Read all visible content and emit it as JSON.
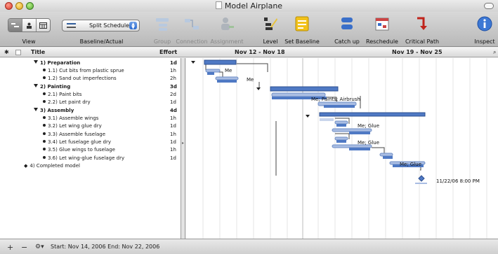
{
  "window": {
    "title": "Model Airplane"
  },
  "toolbar": {
    "view_label": "View",
    "baseline_label": "Baseline/Actual",
    "baseline_popup_value": "Split Schedule",
    "buttons": [
      {
        "label": "Group",
        "enabled": false,
        "icon": "group-icon"
      },
      {
        "label": "Connection",
        "enabled": false,
        "icon": "connection-icon"
      },
      {
        "label": "Assignment",
        "enabled": false,
        "icon": "assignment-icon"
      },
      {
        "label": "Level",
        "enabled": true,
        "icon": "level-icon"
      },
      {
        "label": "Set Baseline",
        "enabled": true,
        "icon": "set-baseline-icon"
      },
      {
        "label": "Catch up",
        "enabled": true,
        "icon": "catch-up-icon"
      },
      {
        "label": "Reschedule",
        "enabled": true,
        "icon": "reschedule-icon"
      },
      {
        "label": "Critical Path",
        "enabled": true,
        "icon": "critical-path-icon"
      },
      {
        "label": "Inspect",
        "enabled": true,
        "icon": "inspect-icon"
      }
    ]
  },
  "columns": {
    "title": "Title",
    "effort": "Effort"
  },
  "timeline": {
    "weeks": [
      "Nov 12 - Nov 18",
      "Nov 19 - Nov 25"
    ]
  },
  "tasks": [
    {
      "title": "1) Preparation",
      "effort": "1d",
      "level": 0,
      "kind": "group"
    },
    {
      "title": "1.1) Cut bits from plastic sprue",
      "effort": "1h",
      "level": 1,
      "kind": "task"
    },
    {
      "title": "1.2) Sand out imperfections",
      "effort": "2h",
      "level": 1,
      "kind": "task"
    },
    {
      "title": "2) Painting",
      "effort": "3d",
      "level": 0,
      "kind": "group"
    },
    {
      "title": "2.1) Paint bits",
      "effort": "2d",
      "level": 1,
      "kind": "task"
    },
    {
      "title": "2.2) Let paint dry",
      "effort": "1d",
      "level": 1,
      "kind": "task"
    },
    {
      "title": "3) Assembly",
      "effort": "4d",
      "level": 0,
      "kind": "group"
    },
    {
      "title": "3.1) Assemble wings",
      "effort": "1h",
      "level": 1,
      "kind": "task"
    },
    {
      "title": "3.2) Let wing glue dry",
      "effort": "1d",
      "level": 1,
      "kind": "task"
    },
    {
      "title": "3.3) Assemble fuselage",
      "effort": "1h",
      "level": 1,
      "kind": "task"
    },
    {
      "title": "3.4) Let fuselage glue dry",
      "effort": "1d",
      "level": 1,
      "kind": "task"
    },
    {
      "title": "3.5) Glue wings to fuselage",
      "effort": "1h",
      "level": 1,
      "kind": "task"
    },
    {
      "title": "3.6) Let wing-glue fuselage dry",
      "effort": "1d",
      "level": 1,
      "kind": "task"
    },
    {
      "title": "4) Completed model",
      "effort": "",
      "level": 0,
      "kind": "milestone"
    }
  ],
  "gantt_labels": {
    "l1": "Me",
    "l2": "Me",
    "l3": "Me; Paints; Airbrush",
    "l4": "Me; Glue",
    "l5": "Me; Glue",
    "l6": "Me; Glue",
    "milestone": "11/22/06 8:00 PM"
  },
  "status": {
    "text": "Start: Nov 14, 2006 End: Nov 22, 2006"
  },
  "colors": {
    "bar": "#4f79c4",
    "baseline": "#a9bde3",
    "accent": "#1f5bbf"
  }
}
